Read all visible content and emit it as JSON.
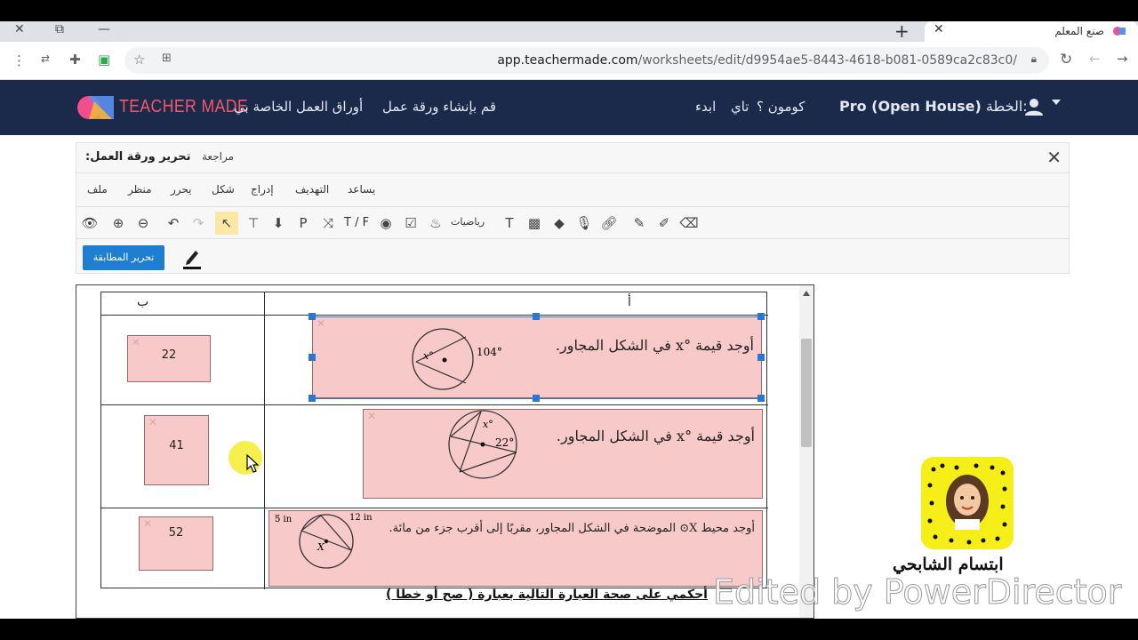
{
  "browser": {
    "tab_title": "صنع المعلم",
    "url_domain": "app.teachermade.com",
    "url_path": "/worksheets/edit/d9954ae5-8443-4618-b081-0589ca2c83c0/"
  },
  "header": {
    "logo_text": "TEACHER MADE",
    "nav_my_worksheets": "أوراق العمل الخاصة بي",
    "nav_create": "قم بإنشاء ورقة عمل",
    "nav_start": "ابدء",
    "nav_tai": "تاي",
    "nav_common": "كومون ؟",
    "plan_label": "الخطة:",
    "plan_value": "Pro (Open House)"
  },
  "editor": {
    "title": "تحرير ورقة العمل:",
    "review": "مراجعة",
    "menu": {
      "file": "ملف",
      "view": "منظر",
      "edit": "يحرر",
      "shape": "شكل",
      "insert": "إدراج",
      "target": "التهديف",
      "help": "يساعد"
    },
    "tool_tf": "T / F",
    "tool_math": "رياضيات",
    "match_button": "تحرير المطابقة"
  },
  "worksheet": {
    "col_b": "ب",
    "col_a": "أ",
    "answers": [
      "22",
      "41",
      "52"
    ],
    "q1_text": "أوجد قيمة °x في الشكل المجاور.",
    "q1_angle": "104°",
    "q1_var": "x°",
    "q2_text": "أوجد قيمة °x في الشكل المجاور.",
    "q2_var": "x°",
    "q2_angle": "22°",
    "q3_text": "أوجد محيط X⊙ الموضحة في الشكل المجاور، مقربًا إلى أقرب جزء من مائة.",
    "q3_len1": "5 in",
    "q3_len2": "12 in",
    "q3_var": "X",
    "instruction": "أحكمي على صحة العبارة التالية بعبارة ( صح أو خطا )"
  },
  "overlay": {
    "snap_name": "ابتسام الشابحي",
    "watermark": "Edited by PowerDirector"
  }
}
